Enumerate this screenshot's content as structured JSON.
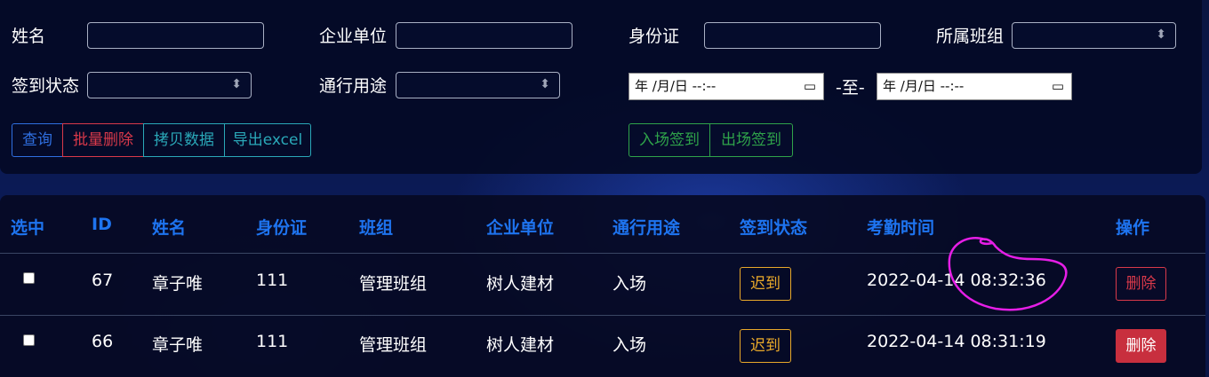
{
  "filters": {
    "name_label": "姓名",
    "company_label": "企业单位",
    "id_card_label": "身份证",
    "team_label": "所属班组",
    "sign_status_label": "签到状态",
    "purpose_label": "通行用途",
    "date_start_placeholder": "年 /月/日 --:--",
    "date_separator": "-至-",
    "date_end_placeholder": "年 /月/日 --:--"
  },
  "toolbar": {
    "query": "查询",
    "batch_delete": "批量删除",
    "copy_data": "拷贝数据",
    "export_excel": "导出excel",
    "entry_sign": "入场签到",
    "exit_sign": "出场签到"
  },
  "table": {
    "headers": [
      "选中",
      "ID",
      "姓名",
      "身份证",
      "班组",
      "企业单位",
      "通行用途",
      "签到状态",
      "考勤时间",
      "操作"
    ],
    "rows": [
      {
        "id": "67",
        "name": "章子唯",
        "id_card": "111",
        "team": "管理班组",
        "company": "树人建材",
        "purpose": "入场",
        "status": "迟到",
        "time": "2022-04-14 08:32:36",
        "action": "删除"
      },
      {
        "id": "66",
        "name": "章子唯",
        "id_card": "111",
        "team": "管理班组",
        "company": "树人建材",
        "purpose": "入场",
        "status": "迟到",
        "time": "2022-04-14 08:31:19",
        "action": "删除"
      }
    ]
  },
  "colors": {
    "header_blue": "#1e74f0",
    "query_border": "#2f6fe0",
    "delete_red": "#d9394a",
    "copy_teal": "#2aa8b8",
    "sign_green": "#2fa34a",
    "late_orange": "#e9a92a",
    "annotation_magenta": "#e61ee6"
  },
  "icons": {
    "select_arrow": "updown-arrow-icon",
    "calendar": "calendar-icon"
  }
}
